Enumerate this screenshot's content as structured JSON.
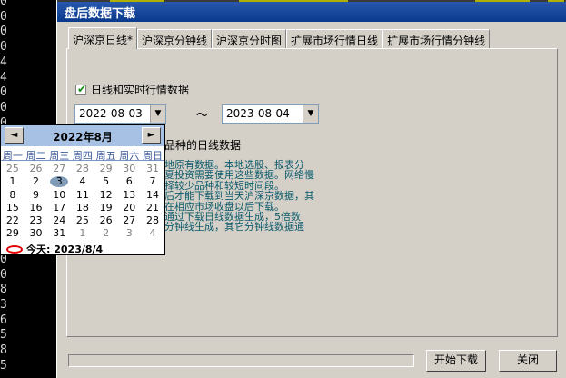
{
  "left_numbers": [
    "0",
    "0",
    "0",
    "0",
    "4",
    "4",
    "0",
    "0",
    "0",
    "4",
    "0",
    "2",
    "2",
    "0",
    "0",
    "0",
    "0",
    "0",
    "0",
    "8",
    "3",
    "6",
    "5",
    "8",
    "5"
  ],
  "dialog": {
    "title": "盘后数据下载"
  },
  "tabs": [
    {
      "label": "沪深京日线*"
    },
    {
      "label": "沪深京分钟线"
    },
    {
      "label": "沪深京分时图"
    },
    {
      "label": "扩展市场行情日线"
    },
    {
      "label": "扩展市场行情分钟线"
    }
  ],
  "checkbox": {
    "label": "日线和实时行情数据",
    "checked": true
  },
  "start_date": "2022-08-03",
  "separator": "～",
  "end_date": "2023-08-04",
  "section_title": "品种的日线数据",
  "description_lines": [
    "地原有数据。本地选股、报表分",
    "夏投资需要使用这些数据。网络慢",
    "择较少品种和较短时间段。",
    "后才能下载到当天沪深京数据，其",
    "在相应市场收盘以后下载。",
    "通过下载日线数据生成，5倍数",
    "分钟线生成，其它分钟线数据通"
  ],
  "buttons": {
    "start": "开始下载",
    "close": "关闭"
  },
  "calendar": {
    "title": "2022年8月",
    "prev": "◄",
    "next": "►",
    "weekdays": [
      "周一",
      "周二",
      "周三",
      "周四",
      "周五",
      "周六",
      "周日"
    ],
    "weeks": [
      [
        [
          "25",
          1
        ],
        [
          "26",
          1
        ],
        [
          "27",
          1
        ],
        [
          "28",
          1
        ],
        [
          "29",
          1
        ],
        [
          "30",
          1
        ],
        [
          "31",
          1
        ]
      ],
      [
        [
          "1",
          0
        ],
        [
          "2",
          0
        ],
        [
          "3",
          2
        ],
        [
          "4",
          0
        ],
        [
          "5",
          0
        ],
        [
          "6",
          0
        ],
        [
          "7",
          0
        ]
      ],
      [
        [
          "8",
          0
        ],
        [
          "9",
          0
        ],
        [
          "10",
          0
        ],
        [
          "11",
          0
        ],
        [
          "12",
          0
        ],
        [
          "13",
          0
        ],
        [
          "14",
          0
        ]
      ],
      [
        [
          "15",
          0
        ],
        [
          "16",
          0
        ],
        [
          "17",
          0
        ],
        [
          "18",
          0
        ],
        [
          "19",
          0
        ],
        [
          "20",
          0
        ],
        [
          "21",
          0
        ]
      ],
      [
        [
          "22",
          0
        ],
        [
          "23",
          0
        ],
        [
          "24",
          0
        ],
        [
          "25",
          0
        ],
        [
          "26",
          0
        ],
        [
          "27",
          0
        ],
        [
          "28",
          0
        ]
      ],
      [
        [
          "29",
          0
        ],
        [
          "30",
          0
        ],
        [
          "31",
          0
        ],
        [
          "1",
          1
        ],
        [
          "2",
          1
        ],
        [
          "3",
          1
        ],
        [
          "4",
          1
        ]
      ]
    ],
    "today_label": "今天:  2023/8/4"
  }
}
